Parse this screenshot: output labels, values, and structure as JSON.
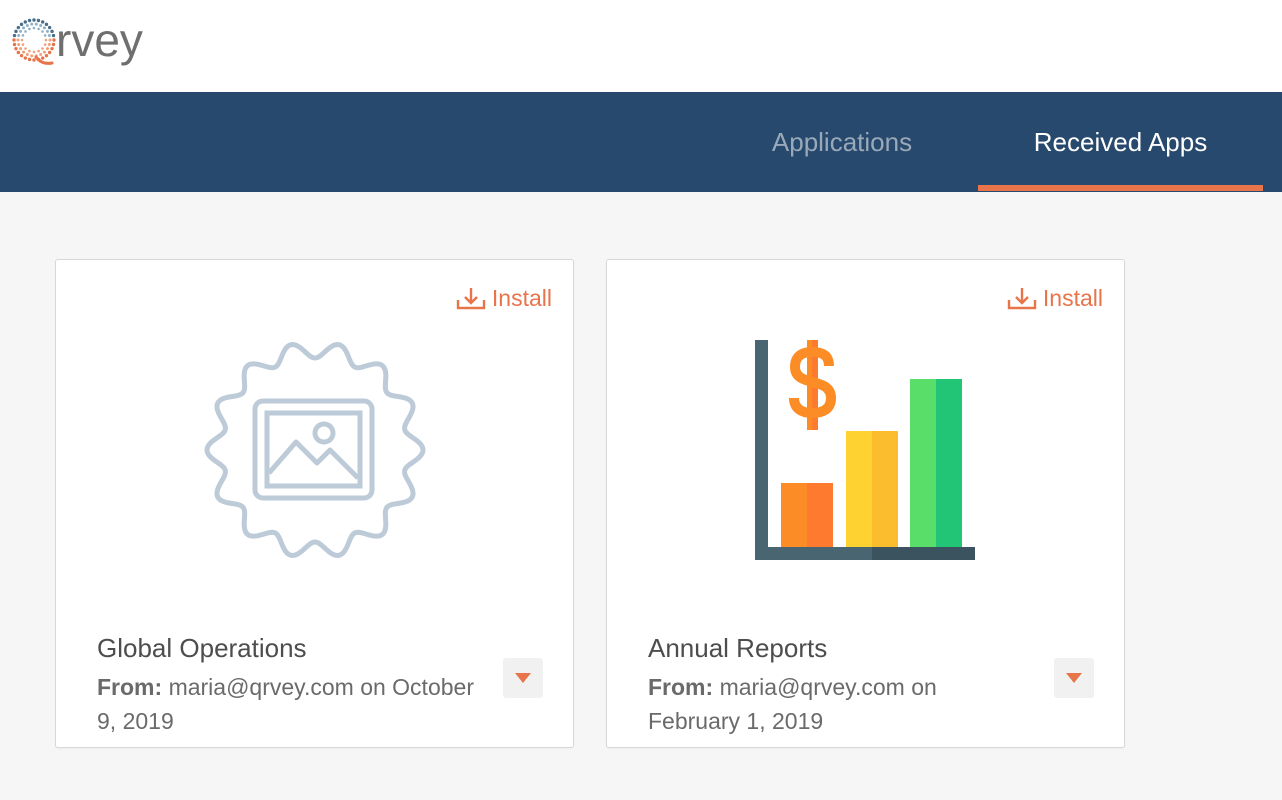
{
  "logo": {
    "text": "rvey",
    "mark": "Q"
  },
  "nav": {
    "tabs": [
      {
        "label": "Applications",
        "active": false
      },
      {
        "label": "Received Apps",
        "active": true
      }
    ]
  },
  "colors": {
    "header_bg": "#27496d",
    "accent": "#e8744a",
    "inactive_tab": "#9aa9b9",
    "page_bg": "#f6f6f6"
  },
  "cards": [
    {
      "title": "Global Operations",
      "from_label": "From:",
      "from_text": "maria@qrvey.com on October 9, 2019",
      "install_label": "Install",
      "image_icon": "placeholder-image-badge-icon"
    },
    {
      "title": "Annual Reports",
      "from_label": "From:",
      "from_text": "maria@qrvey.com on February 1, 2019",
      "install_label": "Install",
      "image_icon": "bar-chart-dollar-icon"
    }
  ]
}
